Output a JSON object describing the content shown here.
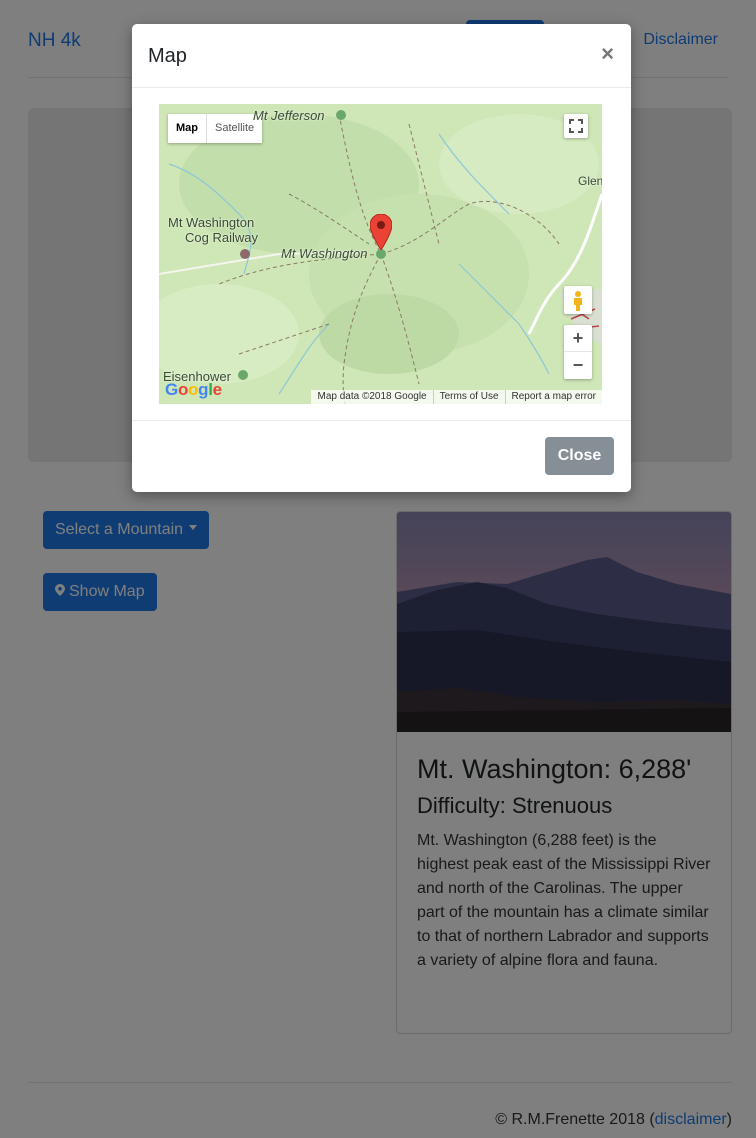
{
  "navbar": {
    "brand": "NH 4k",
    "disclaimer": "Disclaimer"
  },
  "controls": {
    "select_label": "Select a Mountain",
    "show_map_label": "Show Map"
  },
  "card": {
    "title": "Mt. Washington: 6,288'",
    "difficulty": "Difficulty: Strenuous",
    "description": "Mt. Washington (6,288 feet) is the highest peak east of the Mississippi River and north of the Carolinas. The upper part of the mountain has a climate similar to that of northern Labrador and supports a variety of alpine flora and fauna."
  },
  "footer": {
    "copyright": "© R.M.Frenette 2018 (",
    "link": "disclaimer",
    "close_paren": ")"
  },
  "modal": {
    "title": "Map",
    "close_x": "×",
    "close_button": "Close",
    "map": {
      "type_map": "Map",
      "type_satellite": "Satellite",
      "labels": {
        "jefferson": "Mt Jefferson",
        "glen": "Glen",
        "cog1": "Mt Washington",
        "cog2": "Cog Railway",
        "washington": "Mt Washington",
        "eisenhower": "Eisenhower"
      },
      "zoom_in": "+",
      "zoom_out": "−",
      "google": "Google",
      "attrib_data": "Map data ©2018 Google",
      "attrib_terms": "Terms of Use",
      "attrib_report": "Report a map error"
    }
  },
  "colors": {
    "primary": "#1e78e6",
    "secondary": "#868e96",
    "map_green": "#cfe6b6"
  },
  "icons": [
    "map-marker-icon",
    "caret-down-icon",
    "fullscreen-icon",
    "pegman-icon",
    "close-icon",
    "red-pin-icon"
  ]
}
